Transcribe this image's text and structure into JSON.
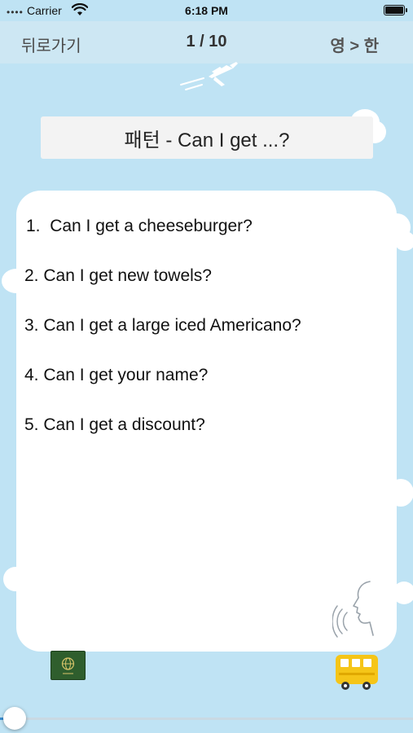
{
  "status_bar": {
    "signal": "••••",
    "carrier": "Carrier",
    "time": "6:18 PM",
    "wifi_icon": "wifi-icon",
    "battery_icon": "battery-icon"
  },
  "nav": {
    "back_label": "뒤로가기",
    "counter": "1 / 10",
    "mode_label": "영 > 한"
  },
  "title": "패턴 - Can I get ...?",
  "sentences": [
    {
      "number": "1.",
      "text": "Can I get a cheeseburger?"
    },
    {
      "number": "2.",
      "text": "Can I get new towels?"
    },
    {
      "number": "3.",
      "text": "Can I get a large iced Americano?"
    },
    {
      "number": "4.",
      "text": "Can I get your name?"
    },
    {
      "number": "5.",
      "text": "Can I get a discount?"
    }
  ],
  "icons": {
    "airplane": "airplane-icon",
    "speaker": "speaking-head-icon",
    "passport": "passport-icon",
    "bus": "bus-icon"
  },
  "progress": {
    "value": 1,
    "total": 10
  },
  "colors": {
    "background": "#bfe3f4",
    "nav_background": "#cde7f3",
    "card": "#ffffff",
    "bus": "#f5c518",
    "passport": "#2f5e2d",
    "slider_fill": "#3b8fd1"
  }
}
